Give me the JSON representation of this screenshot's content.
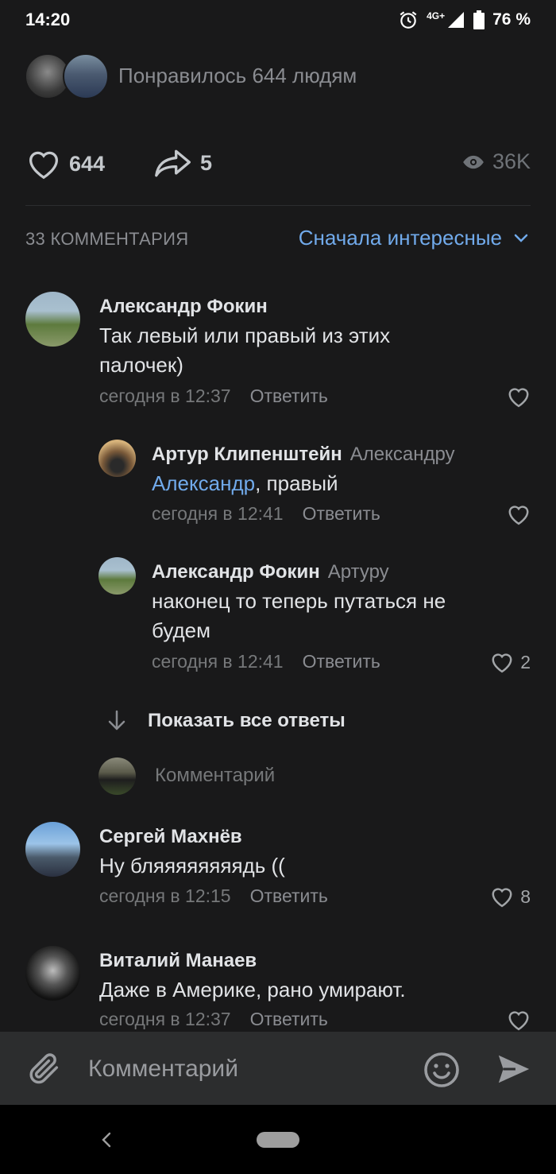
{
  "status": {
    "time": "14:20",
    "network": "4G+",
    "battery": "76 %"
  },
  "post": {
    "liked_text": "Понравилось 644 людям",
    "likes": "644",
    "shares": "5",
    "views": "36K"
  },
  "comments_header": {
    "count_label": "33 КОММЕНТАРИЯ",
    "sort_label": "Сначала интересные"
  },
  "comments": [
    {
      "author": "Александр Фокин",
      "text": "Так левый или правый из этих палочек)",
      "time": "сегодня в 12:37",
      "reply_label": "Ответить",
      "likes": ""
    },
    {
      "author": "Артур Клипенштейн",
      "reply_to": "Александру",
      "mention": "Александр",
      "text": ", правый",
      "time": "сегодня в 12:41",
      "reply_label": "Ответить",
      "likes": ""
    },
    {
      "author": "Александр Фокин",
      "reply_to": "Артуру",
      "text": "наконец то теперь путаться не будем",
      "time": "сегодня в 12:41",
      "reply_label": "Ответить",
      "likes": "2"
    },
    {
      "author": "Сергей Махнёв",
      "text": "Ну бляяяяяяяядь ((",
      "time": "сегодня в 12:15",
      "reply_label": "Ответить",
      "likes": "8"
    },
    {
      "author": "Виталий Манаев",
      "text": "Даже в Америке, рано умирают.",
      "time": "сегодня в 12:37",
      "reply_label": "Ответить",
      "likes": ""
    }
  ],
  "thread": {
    "show_all_label": "Показать все ответы",
    "reply_placeholder": "Комментарий"
  },
  "composer": {
    "placeholder": "Комментарий"
  },
  "colors": {
    "accent": "#71aaeb",
    "background": "#19191a",
    "muted": "#76787a"
  },
  "icons": [
    "alarm-icon",
    "signal-icon",
    "battery-icon",
    "heart-icon",
    "share-icon",
    "eye-icon",
    "chevron-down-icon",
    "arrow-down-icon",
    "paperclip-icon",
    "smile-icon",
    "send-icon",
    "back-nav-icon"
  ]
}
